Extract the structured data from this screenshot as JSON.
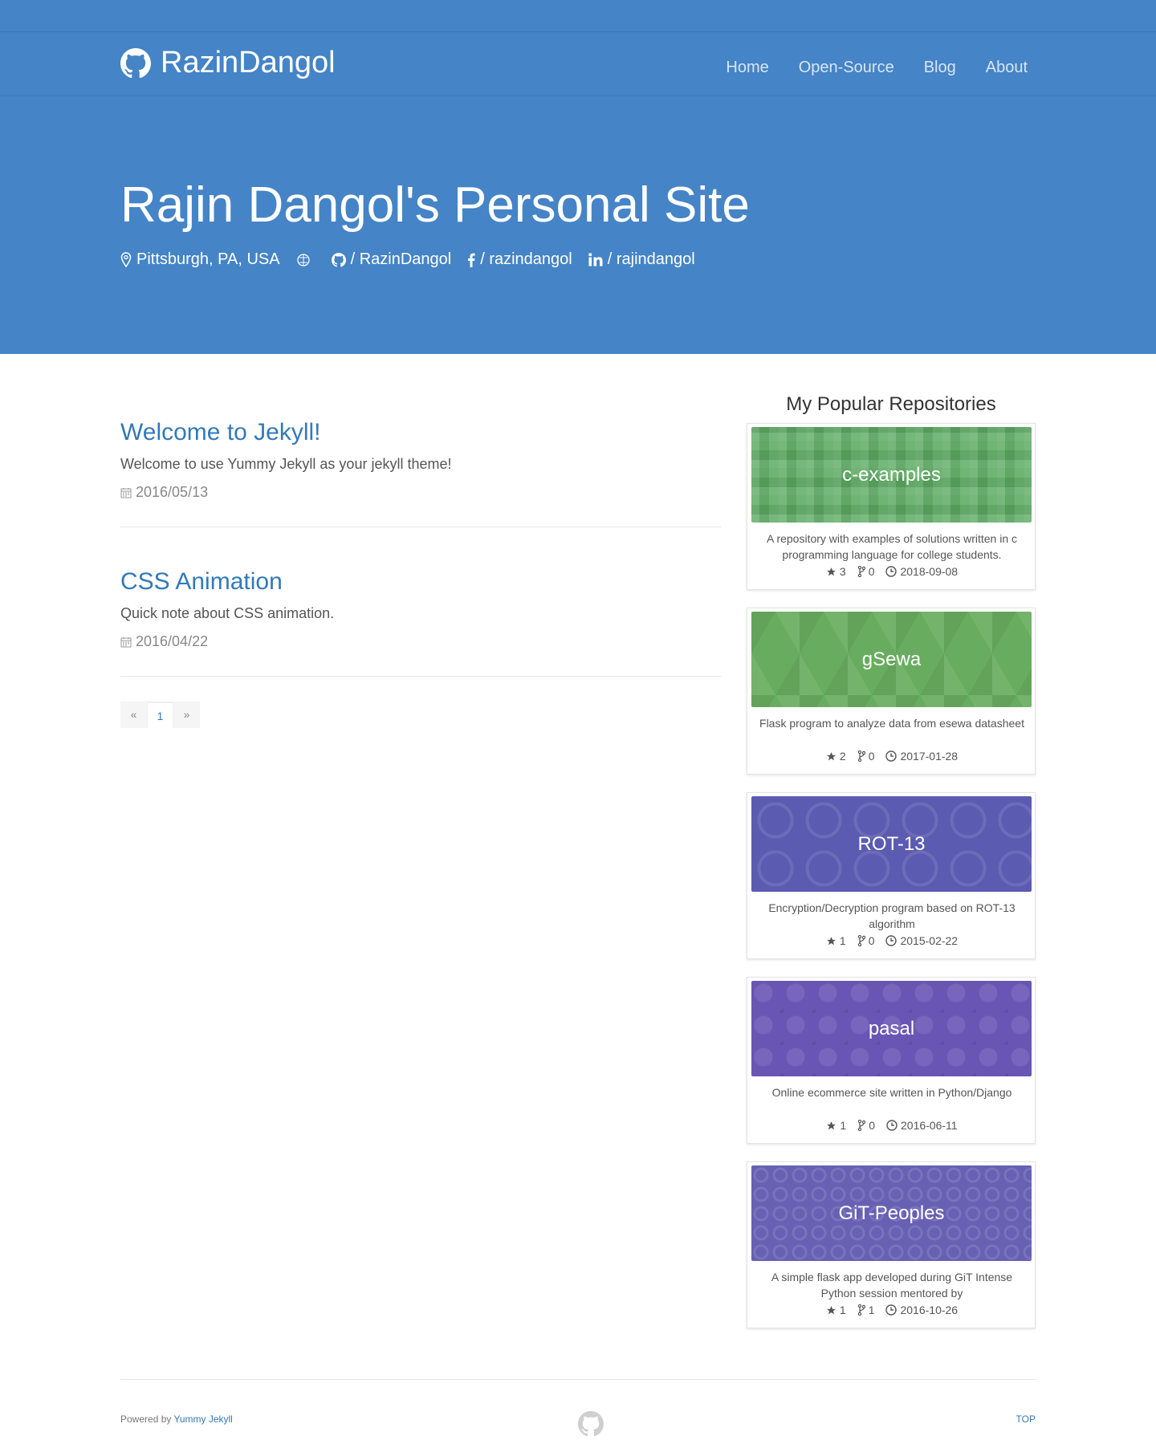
{
  "colors": {
    "hero": "#4584c6",
    "link": "#3379b7"
  },
  "nav": {
    "brand": "RazinDangol",
    "items": [
      "Home",
      "Open-Source",
      "Blog",
      "About"
    ]
  },
  "hero": {
    "title": "Rajin Dangol's Personal Site",
    "location": "Pittsburgh, PA, USA",
    "github": "/ RazinDangol",
    "facebook": "/ razindangol",
    "linkedin": "/ rajindangol"
  },
  "posts": [
    {
      "title": "Welcome to Jekyll!",
      "excerpt": "Welcome to use Yummy Jekyll as your jekyll theme!",
      "date": "2016/05/13"
    },
    {
      "title": "CSS Animation",
      "excerpt": "Quick note about CSS animation.",
      "date": "2016/04/22"
    }
  ],
  "pagination": {
    "prev": "«",
    "current": "1",
    "next": "»"
  },
  "sidebar": {
    "title": "My Popular Repositories",
    "repos": [
      {
        "name": "c-examples",
        "desc": "A repository with examples of solutions written in c programming language for college students.",
        "stars": "3",
        "forks": "0",
        "date": "2018-09-08"
      },
      {
        "name": "gSewa",
        "desc": "Flask program to analyze data from esewa datasheet",
        "stars": "2",
        "forks": "0",
        "date": "2017-01-28"
      },
      {
        "name": "ROT-13",
        "desc": "Encryption/Decryption program based on ROT-13 algorithm",
        "stars": "1",
        "forks": "0",
        "date": "2015-02-22"
      },
      {
        "name": "pasal",
        "desc": "Online ecommerce site written in Python/Django",
        "stars": "1",
        "forks": "0",
        "date": "2016-06-11"
      },
      {
        "name": "GiT-Peoples",
        "desc": "A simple flask app developed during GiT Intense Python session mentored by",
        "stars": "1",
        "forks": "1",
        "date": "2016-10-26"
      }
    ]
  },
  "footer": {
    "powered": "Powered by",
    "theme": "Yummy Jekyll",
    "top": "TOP"
  }
}
